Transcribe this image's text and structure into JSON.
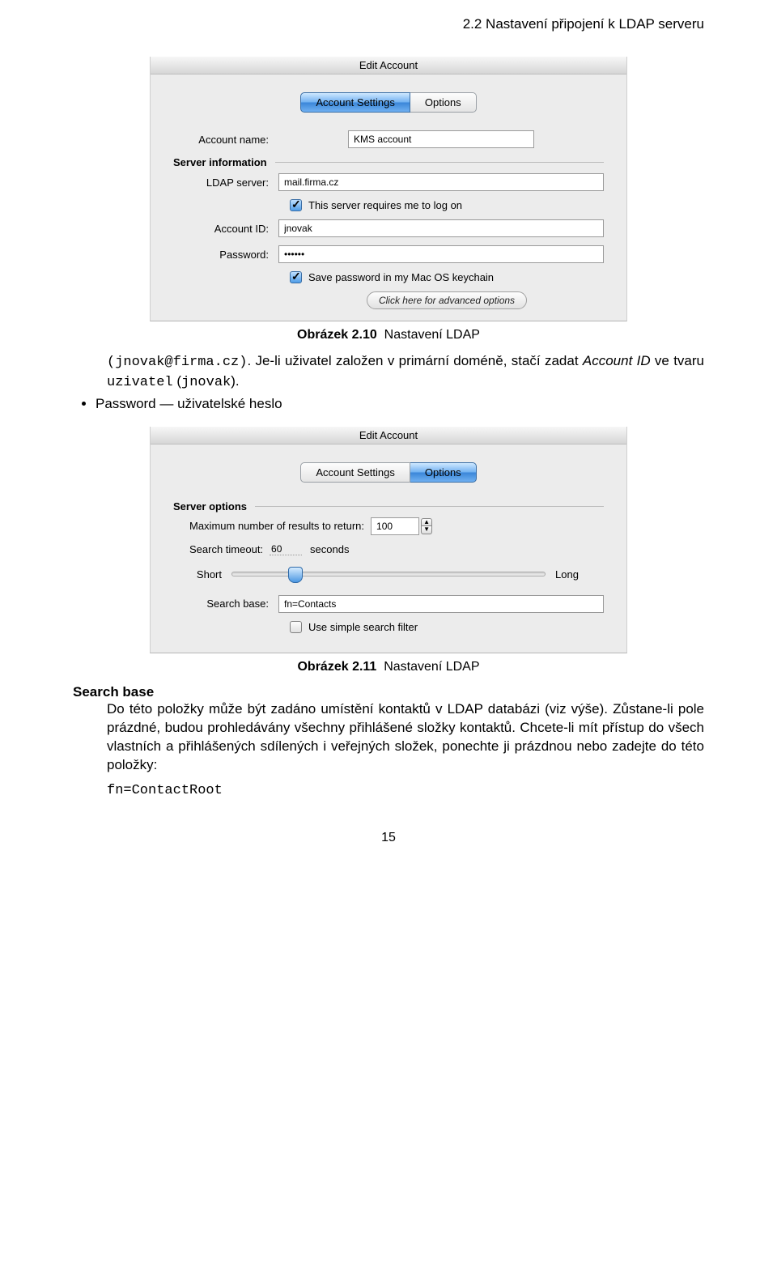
{
  "running_header": "2.2 Nastavení připojení k LDAP serveru",
  "caption1_prefix": "Obrázek 2.10",
  "caption1_rest": "Nastavení LDAP",
  "caption2_prefix": "Obrázek 2.11",
  "caption2_rest": "Nastavení LDAP",
  "intro": {
    "mono1": "(jnovak@firma.cz)",
    "sent1a": ". Je-li uživatel založen v primární doméně, stačí zadat ",
    "italic1": "Account ID",
    "sent1b": " ve tvaru ",
    "mono2": "uzivatel",
    "sent1c": " (",
    "mono3": "jnovak",
    "sent1d": ")."
  },
  "bullet": {
    "italic": "Password",
    "rest": " — uživatelské heslo"
  },
  "search": {
    "label": "Search base",
    "p1": "Do této položky může být zadáno umístění kontaktů v LDAP databázi (viz výše). Zůstane-li pole prázdné, budou prohledávány všechny přihlášené složky kontaktů. Chcete-li mít přístup do všech vlastních a přihlášených sdílených i veřejných složek, ponechte ji prázdnou nebo zadejte do této položky:",
    "mono": "fn=ContactRoot"
  },
  "page_number": "15",
  "panel1": {
    "title": "Edit Account",
    "tab1": "Account Settings",
    "tab2": "Options",
    "lbl_account_name": "Account name:",
    "val_account_name": "KMS account",
    "group_server_info": "Server information",
    "lbl_ldap_server": "LDAP server:",
    "val_ldap_server": "mail.firma.cz",
    "chk_requires_logon": "This server requires me to log on",
    "lbl_account_id": "Account ID:",
    "val_account_id": "jnovak",
    "lbl_password": "Password:",
    "val_password": "••••••",
    "chk_save_keychain": "Save password in my Mac OS keychain",
    "btn_advanced": "Click here for advanced options"
  },
  "panel2": {
    "title": "Edit Account",
    "tab1": "Account Settings",
    "tab2": "Options",
    "group_server_options": "Server options",
    "lbl_max_results": "Maximum number of results to return:",
    "val_max_results": "100",
    "lbl_search_timeout": "Search timeout:",
    "val_search_timeout": "60",
    "unit_seconds": "seconds",
    "slider_short": "Short",
    "slider_long": "Long",
    "slider_pos_pct": 18,
    "lbl_search_base": "Search base:",
    "val_search_base": "fn=Contacts",
    "chk_simple_filter": "Use simple search filter"
  }
}
